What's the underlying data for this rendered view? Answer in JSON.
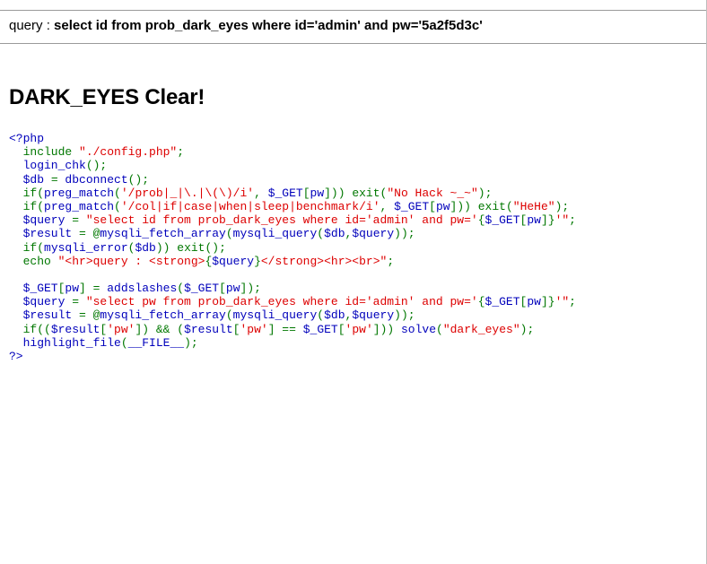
{
  "result": {
    "query_label": "query : ",
    "query_text": "select id from prob_dark_eyes where id='admin' and pw='5a2f5d3c'"
  },
  "title": "DARK_EYES Clear!",
  "source_code": [
    [
      {
        "t": "<?php",
        "c": "default"
      }
    ],
    [
      {
        "t": "  include ",
        "c": "keyword"
      },
      {
        "t": "\"./config.php\"",
        "c": "string"
      },
      {
        "t": ";",
        "c": "keyword"
      }
    ],
    [
      {
        "t": "  login_chk",
        "c": "default"
      },
      {
        "t": "();",
        "c": "keyword"
      }
    ],
    [
      {
        "t": "  $db ",
        "c": "default"
      },
      {
        "t": "= ",
        "c": "keyword"
      },
      {
        "t": "dbconnect",
        "c": "default"
      },
      {
        "t": "();",
        "c": "keyword"
      }
    ],
    [
      {
        "t": "  if(",
        "c": "keyword"
      },
      {
        "t": "preg_match",
        "c": "default"
      },
      {
        "t": "(",
        "c": "keyword"
      },
      {
        "t": "'/prob|_|\\.|\\(\\)/i'",
        "c": "string"
      },
      {
        "t": ", ",
        "c": "keyword"
      },
      {
        "t": "$_GET",
        "c": "default"
      },
      {
        "t": "[",
        "c": "keyword"
      },
      {
        "t": "pw",
        "c": "default"
      },
      {
        "t": "])) exit(",
        "c": "keyword"
      },
      {
        "t": "\"No Hack ~_~\"",
        "c": "string"
      },
      {
        "t": ");",
        "c": "keyword"
      }
    ],
    [
      {
        "t": "  if(",
        "c": "keyword"
      },
      {
        "t": "preg_match",
        "c": "default"
      },
      {
        "t": "(",
        "c": "keyword"
      },
      {
        "t": "'/col|if|case|when|sleep|benchmark/i'",
        "c": "string"
      },
      {
        "t": ", ",
        "c": "keyword"
      },
      {
        "t": "$_GET",
        "c": "default"
      },
      {
        "t": "[",
        "c": "keyword"
      },
      {
        "t": "pw",
        "c": "default"
      },
      {
        "t": "])) exit(",
        "c": "keyword"
      },
      {
        "t": "\"HeHe\"",
        "c": "string"
      },
      {
        "t": ");",
        "c": "keyword"
      }
    ],
    [
      {
        "t": "  $query ",
        "c": "default"
      },
      {
        "t": "= ",
        "c": "keyword"
      },
      {
        "t": "\"select id from prob_dark_eyes where id='admin' and pw='",
        "c": "string"
      },
      {
        "t": "{",
        "c": "keyword"
      },
      {
        "t": "$_GET",
        "c": "default"
      },
      {
        "t": "[",
        "c": "keyword"
      },
      {
        "t": "pw",
        "c": "default"
      },
      {
        "t": "]}",
        "c": "keyword"
      },
      {
        "t": "'\"",
        "c": "string"
      },
      {
        "t": ";",
        "c": "keyword"
      }
    ],
    [
      {
        "t": "  $result ",
        "c": "default"
      },
      {
        "t": "= @",
        "c": "keyword"
      },
      {
        "t": "mysqli_fetch_array",
        "c": "default"
      },
      {
        "t": "(",
        "c": "keyword"
      },
      {
        "t": "mysqli_query",
        "c": "default"
      },
      {
        "t": "(",
        "c": "keyword"
      },
      {
        "t": "$db",
        "c": "default"
      },
      {
        "t": ",",
        "c": "keyword"
      },
      {
        "t": "$query",
        "c": "default"
      },
      {
        "t": "));",
        "c": "keyword"
      }
    ],
    [
      {
        "t": "  if(",
        "c": "keyword"
      },
      {
        "t": "mysqli_error",
        "c": "default"
      },
      {
        "t": "(",
        "c": "keyword"
      },
      {
        "t": "$db",
        "c": "default"
      },
      {
        "t": ")) exit();",
        "c": "keyword"
      }
    ],
    [
      {
        "t": "  echo ",
        "c": "keyword"
      },
      {
        "t": "\"<hr>query : <strong>",
        "c": "string"
      },
      {
        "t": "{",
        "c": "keyword"
      },
      {
        "t": "$query",
        "c": "default"
      },
      {
        "t": "}",
        "c": "keyword"
      },
      {
        "t": "</strong><hr><br>\"",
        "c": "string"
      },
      {
        "t": ";",
        "c": "keyword"
      }
    ],
    [
      {
        "t": "",
        "c": "default"
      }
    ],
    [
      {
        "t": "  $_GET",
        "c": "default"
      },
      {
        "t": "[",
        "c": "keyword"
      },
      {
        "t": "pw",
        "c": "default"
      },
      {
        "t": "] = ",
        "c": "keyword"
      },
      {
        "t": "addslashes",
        "c": "default"
      },
      {
        "t": "(",
        "c": "keyword"
      },
      {
        "t": "$_GET",
        "c": "default"
      },
      {
        "t": "[",
        "c": "keyword"
      },
      {
        "t": "pw",
        "c": "default"
      },
      {
        "t": "]);",
        "c": "keyword"
      }
    ],
    [
      {
        "t": "  $query ",
        "c": "default"
      },
      {
        "t": "= ",
        "c": "keyword"
      },
      {
        "t": "\"select pw from prob_dark_eyes where id='admin' and pw='",
        "c": "string"
      },
      {
        "t": "{",
        "c": "keyword"
      },
      {
        "t": "$_GET",
        "c": "default"
      },
      {
        "t": "[",
        "c": "keyword"
      },
      {
        "t": "pw",
        "c": "default"
      },
      {
        "t": "]}",
        "c": "keyword"
      },
      {
        "t": "'\"",
        "c": "string"
      },
      {
        "t": ";",
        "c": "keyword"
      }
    ],
    [
      {
        "t": "  $result ",
        "c": "default"
      },
      {
        "t": "= @",
        "c": "keyword"
      },
      {
        "t": "mysqli_fetch_array",
        "c": "default"
      },
      {
        "t": "(",
        "c": "keyword"
      },
      {
        "t": "mysqli_query",
        "c": "default"
      },
      {
        "t": "(",
        "c": "keyword"
      },
      {
        "t": "$db",
        "c": "default"
      },
      {
        "t": ",",
        "c": "keyword"
      },
      {
        "t": "$query",
        "c": "default"
      },
      {
        "t": "));",
        "c": "keyword"
      }
    ],
    [
      {
        "t": "  if((",
        "c": "keyword"
      },
      {
        "t": "$result",
        "c": "default"
      },
      {
        "t": "[",
        "c": "keyword"
      },
      {
        "t": "'pw'",
        "c": "string"
      },
      {
        "t": "]) && (",
        "c": "keyword"
      },
      {
        "t": "$result",
        "c": "default"
      },
      {
        "t": "[",
        "c": "keyword"
      },
      {
        "t": "'pw'",
        "c": "string"
      },
      {
        "t": "] == ",
        "c": "keyword"
      },
      {
        "t": "$_GET",
        "c": "default"
      },
      {
        "t": "[",
        "c": "keyword"
      },
      {
        "t": "'pw'",
        "c": "string"
      },
      {
        "t": "])) ",
        "c": "keyword"
      },
      {
        "t": "solve",
        "c": "default"
      },
      {
        "t": "(",
        "c": "keyword"
      },
      {
        "t": "\"dark_eyes\"",
        "c": "string"
      },
      {
        "t": ");",
        "c": "keyword"
      }
    ],
    [
      {
        "t": "  highlight_file",
        "c": "default"
      },
      {
        "t": "(",
        "c": "keyword"
      },
      {
        "t": "__FILE__",
        "c": "default"
      },
      {
        "t": ");",
        "c": "keyword"
      }
    ],
    [
      {
        "t": "?>",
        "c": "default"
      }
    ]
  ],
  "colors": {
    "default": "#0000bb",
    "keyword": "#007700",
    "string": "#dd0000",
    "rule": "#9a9a9a"
  }
}
